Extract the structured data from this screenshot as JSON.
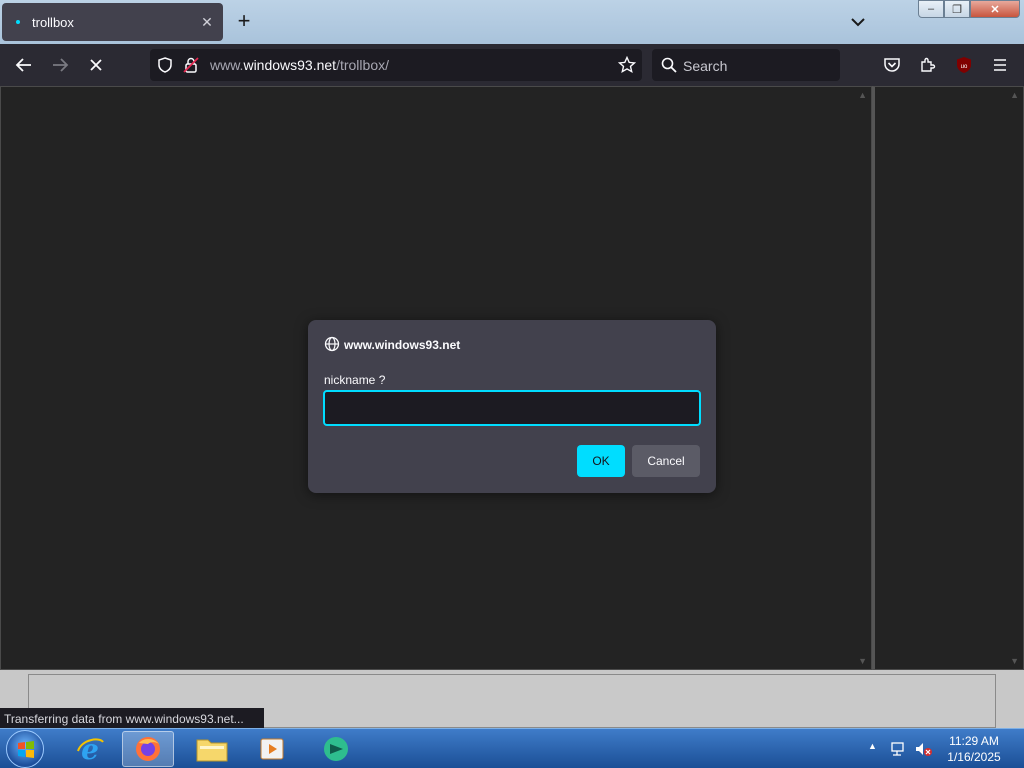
{
  "tab": {
    "title": "trollbox",
    "close": "✕"
  },
  "newtab": "+",
  "window_controls": {
    "minimize": "–",
    "maximize": "❐",
    "close": "✕"
  },
  "urlbar": {
    "prefix": "www.",
    "domain": "windows93.net",
    "path": "/trollbox/"
  },
  "searchbar": {
    "placeholder": "Search"
  },
  "dialog": {
    "origin": "www.windows93.net",
    "message": "nickname ?",
    "input_value": "",
    "ok_label": "OK",
    "cancel_label": "Cancel"
  },
  "status_text": "Transferring data from www.windows93.net...",
  "clock": {
    "time": "11:29 AM",
    "date": "1/16/2025"
  },
  "colors": {
    "accent": "#00ddff",
    "dialog_bg": "#42414d",
    "toolbar_bg": "#2b2a33"
  },
  "taskbar_items": [
    "internet-explorer-icon",
    "firefox-icon",
    "file-explorer-icon",
    "media-player-icon",
    "app-icon"
  ]
}
